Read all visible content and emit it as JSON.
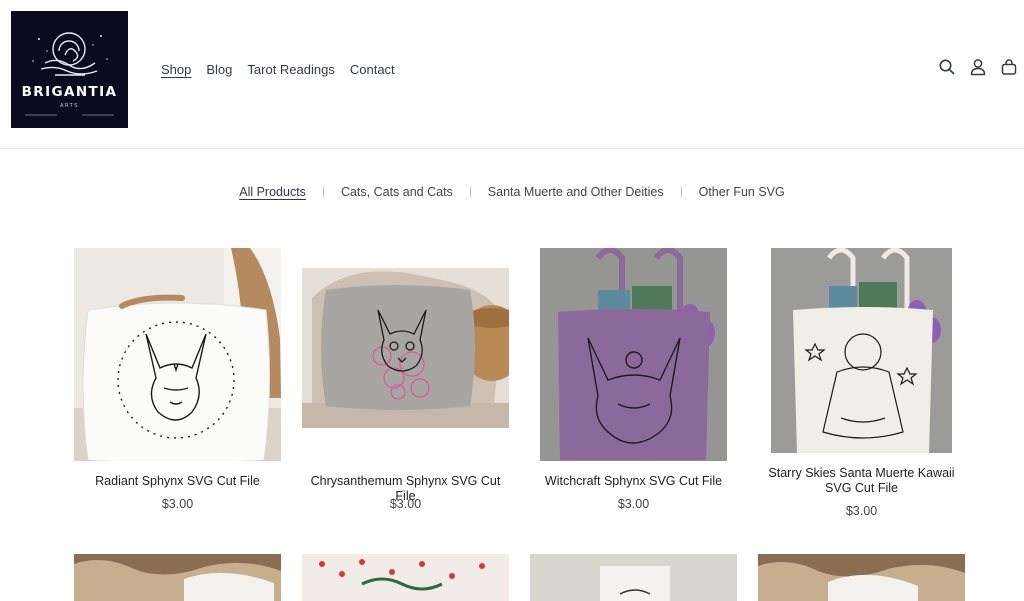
{
  "brand": {
    "name": "BRIGANTIA",
    "sub": "ARTS"
  },
  "nav": {
    "items": [
      "Shop",
      "Blog",
      "Tarot Readings",
      "Contact"
    ]
  },
  "header_icons": [
    "search-icon",
    "account-icon",
    "cart-icon"
  ],
  "categories": [
    "All Products",
    "Cats, Cats and Cats",
    "Santa Muerte and Other Deities",
    "Other Fun SVG"
  ],
  "products": [
    {
      "title": "Radiant Sphynx SVG Cut File",
      "price": "$3.00"
    },
    {
      "title": "Chrysanthemum Sphynx SVG Cut File",
      "price": "$3.00"
    },
    {
      "title": "Witchcraft Sphynx SVG Cut File",
      "price": "$3.00"
    },
    {
      "title": "Starry Skies Santa Muerte Kawaii SVG Cut File",
      "price": "$3.00"
    }
  ],
  "colors": {
    "logo_bg": "#0b0b1f",
    "nav_text": "#333a4a",
    "tote_purple": "#8b6a9b"
  }
}
